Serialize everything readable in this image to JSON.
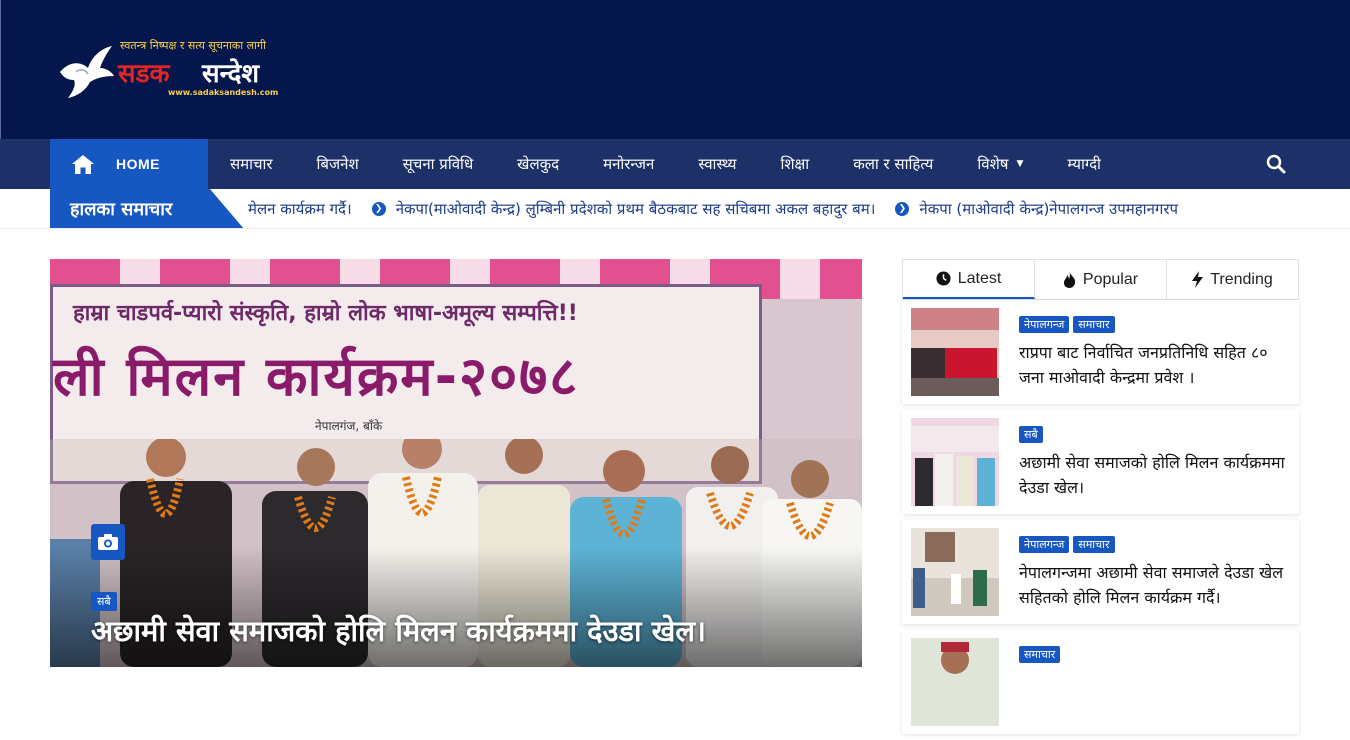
{
  "logo": {
    "tagline": "स्वतन्त्र निष्पक्ष र सत्य सूचनाका लागी",
    "name_part1": "सडक",
    "name_part2": "सन्देश",
    "url": "www.sadaksandesh.com",
    "icon": "dove-icon"
  },
  "nav": {
    "home_label": "HOME",
    "items": [
      "समाचार",
      "बिजनेश",
      "सूचना प्रविधि",
      "खेलकुद",
      "मनोरन्जन",
      "स्वास्थ्य",
      "शिक्षा",
      "कला र साहित्य",
      "विशेष",
      "म्याग्दी"
    ],
    "search_icon": "search-icon"
  },
  "ticker": {
    "label": "हालका समाचार",
    "items": [
      "मेलन कार्यक्रम गर्दै।",
      "नेकपा(माओवादी केन्द्र) लुम्बिनी प्रदेशको प्रथम बैठकबाट सह सचिबमा अकल बहादुर बम।",
      "नेकपा (माओवादी केन्द्र)नेपालगन्ज उपमहानगरप"
    ]
  },
  "hero": {
    "banner_line1": "हाम्रा चाडपर्व-प्यारो संस्कृति, हाम्रो लोक भाषा-अमूल्य सम्पत्ति!!",
    "banner_line2": "ली मिलन कार्यक्रम-२०७८",
    "banner_line3": "नेपालगंज, बाँके",
    "category": "सबै",
    "title": "अछामी सेवा समाजको होलि मिलन कार्यक्रममा देउडा खेल।"
  },
  "tabs": [
    "Latest",
    "Popular",
    "Trending"
  ],
  "news": [
    {
      "cats": [
        "नेपालगन्ज",
        "समाचार"
      ],
      "headline": "राप्रपा बाट निर्वाचित जनप्रतिनिधि सहित ८० जना माओवादी केन्द्रमा प्रवेश ।"
    },
    {
      "cats": [
        "सबै"
      ],
      "headline": "अछामी सेवा समाजको होलि मिलन कार्यक्रममा देउडा खेल।"
    },
    {
      "cats": [
        "नेपालगन्ज",
        "समाचार"
      ],
      "headline": "नेपालगन्जमा अछामी सेवा समाजले देउडा खेल सहितको होलि मिलन कार्यक्रम गर्दै।"
    },
    {
      "cats": [
        "समाचार"
      ],
      "headline": ""
    }
  ],
  "colors": {
    "header_bg": "#05164d",
    "nav_bg": "#1d3067",
    "accent": "#1657c2"
  }
}
